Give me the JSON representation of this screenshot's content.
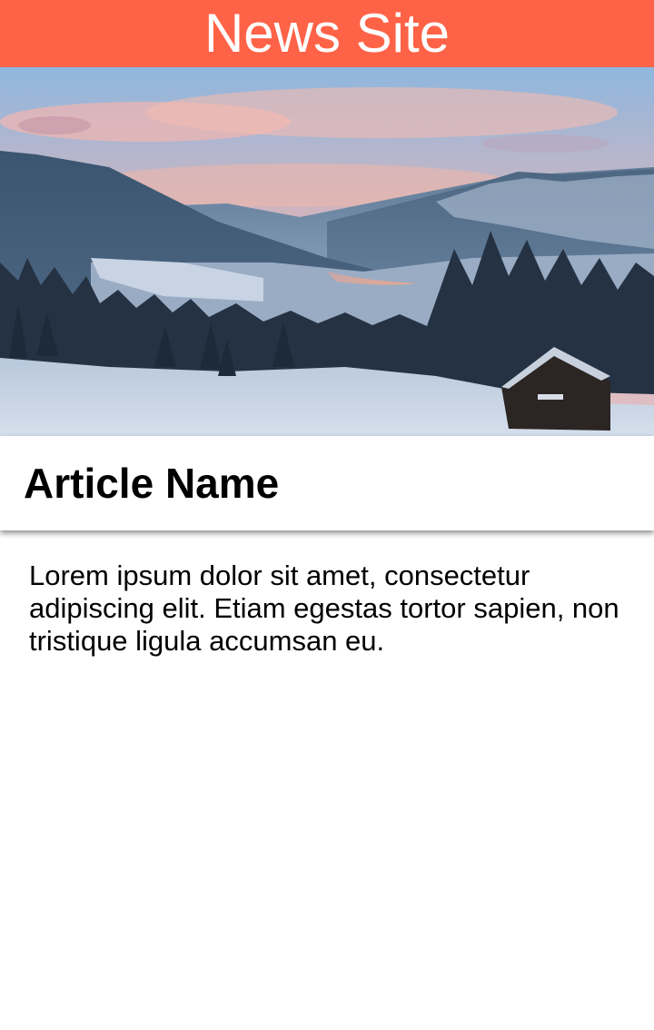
{
  "header": {
    "title": "News Site",
    "background": "#ff6347"
  },
  "hero": {
    "alt": "Snowy mountain valley at dusk with a small cabin"
  },
  "article": {
    "title": "Article Name",
    "body": "Lorem ipsum dolor sit amet, consectetur adipiscing elit. Etiam egestas tortor sapien, non tristique ligula accumsan eu."
  }
}
